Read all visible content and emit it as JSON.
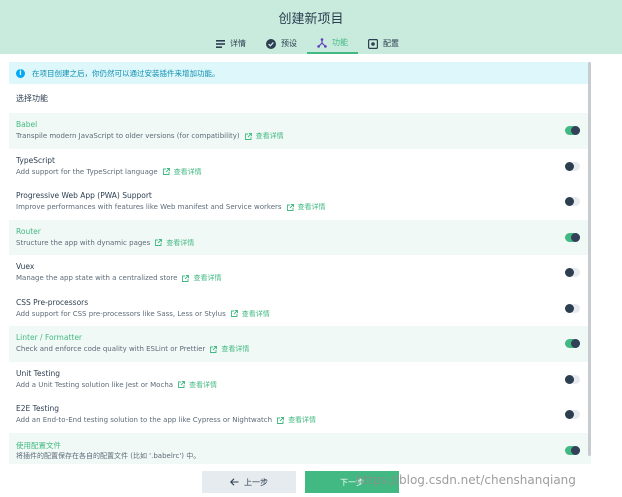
{
  "header": {
    "title": "创建新项目",
    "tabs": [
      {
        "label": "详情",
        "icon": "details-icon",
        "active": false
      },
      {
        "label": "预设",
        "icon": "check-circle-icon",
        "active": false
      },
      {
        "label": "功能",
        "icon": "features-icon",
        "active": true
      },
      {
        "label": "配置",
        "icon": "config-icon",
        "active": false
      }
    ]
  },
  "info": {
    "text": "在项目创建之后，你仍然可以通过安装插件来增加功能。"
  },
  "section_title": "选择功能",
  "more_label": "查看详情",
  "features": [
    {
      "name": "Babel",
      "desc": "Transpile modern JavaScript to older versions (for compatibility)",
      "enabled": true,
      "has_more": true
    },
    {
      "name": "TypeScript",
      "desc": "Add support for the TypeScript language",
      "enabled": false,
      "has_more": true
    },
    {
      "name": "Progressive Web App (PWA) Support",
      "desc": "Improve performances with features like Web manifest and Service workers",
      "enabled": false,
      "has_more": true
    },
    {
      "name": "Router",
      "desc": "Structure the app with dynamic pages",
      "enabled": true,
      "has_more": true
    },
    {
      "name": "Vuex",
      "desc": "Manage the app state with a centralized store",
      "enabled": false,
      "has_more": true
    },
    {
      "name": "CSS Pre-processors",
      "desc": "Add support for CSS pre-processors like Sass, Less or Stylus",
      "enabled": false,
      "has_more": true
    },
    {
      "name": "Linter / Formatter",
      "desc": "Check and enforce code quality with ESLint or Prettier",
      "enabled": true,
      "has_more": true
    },
    {
      "name": "Unit Testing",
      "desc": "Add a Unit Testing solution like Jest or Mocha",
      "enabled": false,
      "has_more": true
    },
    {
      "name": "E2E Testing",
      "desc": "Add an End-to-End testing solution to the app like Cypress or Nightwatch",
      "enabled": false,
      "has_more": true
    },
    {
      "name": "使用配置文件",
      "desc": "将插件的配置保存在各自的配置文件 (比如 '.babelrc') 中。",
      "enabled": true,
      "has_more": false
    }
  ],
  "footer": {
    "prev_label": "上一步",
    "next_label": "下一步"
  },
  "watermark": "https://blog.csdn.net/chenshanqiang",
  "colors": {
    "accent": "#42b983",
    "header_bg": "#c8ebdd",
    "info_bg": "#def7fb",
    "info_text": "#0c8fb0",
    "dark": "#2c3e50"
  }
}
